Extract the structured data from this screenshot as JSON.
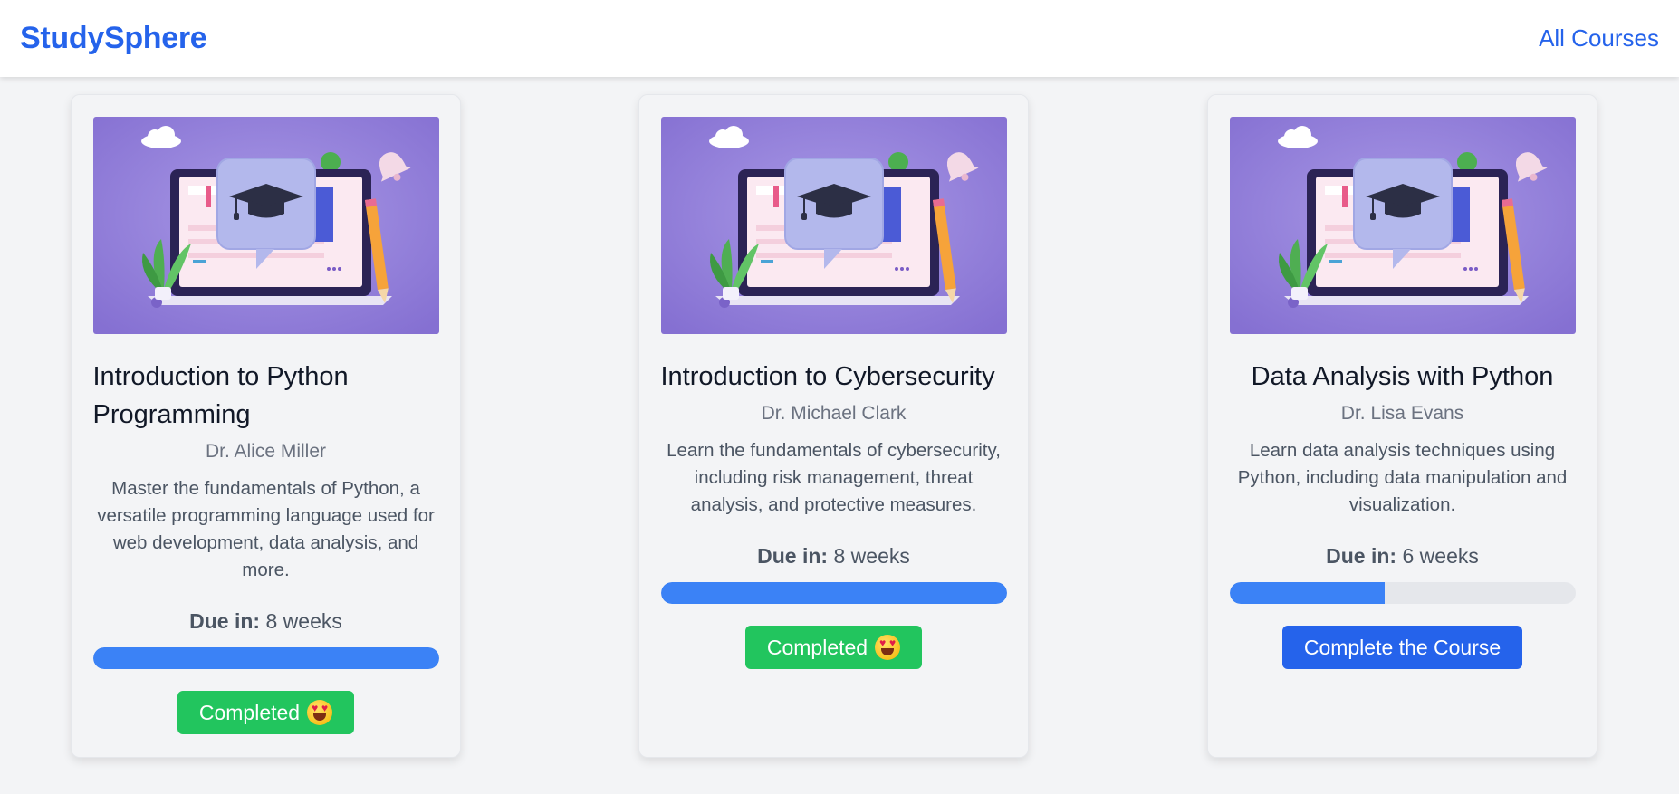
{
  "nav": {
    "brand": "StudySphere",
    "all_courses": "All Courses"
  },
  "courses": [
    {
      "title": "Introduction to Python Programming",
      "instructor": "Dr. Alice Miller",
      "description": "Master the fundamentals of Python, a versatile programming language used for web development, data analysis, and more.",
      "due_label": "Due in:",
      "due_value": "8 weeks",
      "progress": 1.0,
      "button_label": "Completed",
      "button_icon": "heart-eyes-emoji"
    },
    {
      "title": "Introduction to Cybersecurity",
      "instructor": "Dr. Michael Clark",
      "description": "Learn the fundamentals of cybersecurity, including risk management, threat analysis, and protective measures.",
      "due_label": "Due in:",
      "due_value": "8 weeks",
      "progress": 1.0,
      "button_label": "Completed",
      "button_icon": "heart-eyes-emoji"
    },
    {
      "title": "Data Analysis with Python",
      "instructor": "Dr. Lisa Evans",
      "description": "Learn data analysis techniques using Python, including data manipulation and visualization.",
      "due_label": "Due in:",
      "due_value": "6 weeks",
      "progress": 0.45,
      "button_label": "Complete the Course"
    }
  ],
  "colors": {
    "brand": "#2563eb",
    "progress": "#3b82f6",
    "completed": "#22c55e",
    "image_bg": "#8b78d6"
  }
}
